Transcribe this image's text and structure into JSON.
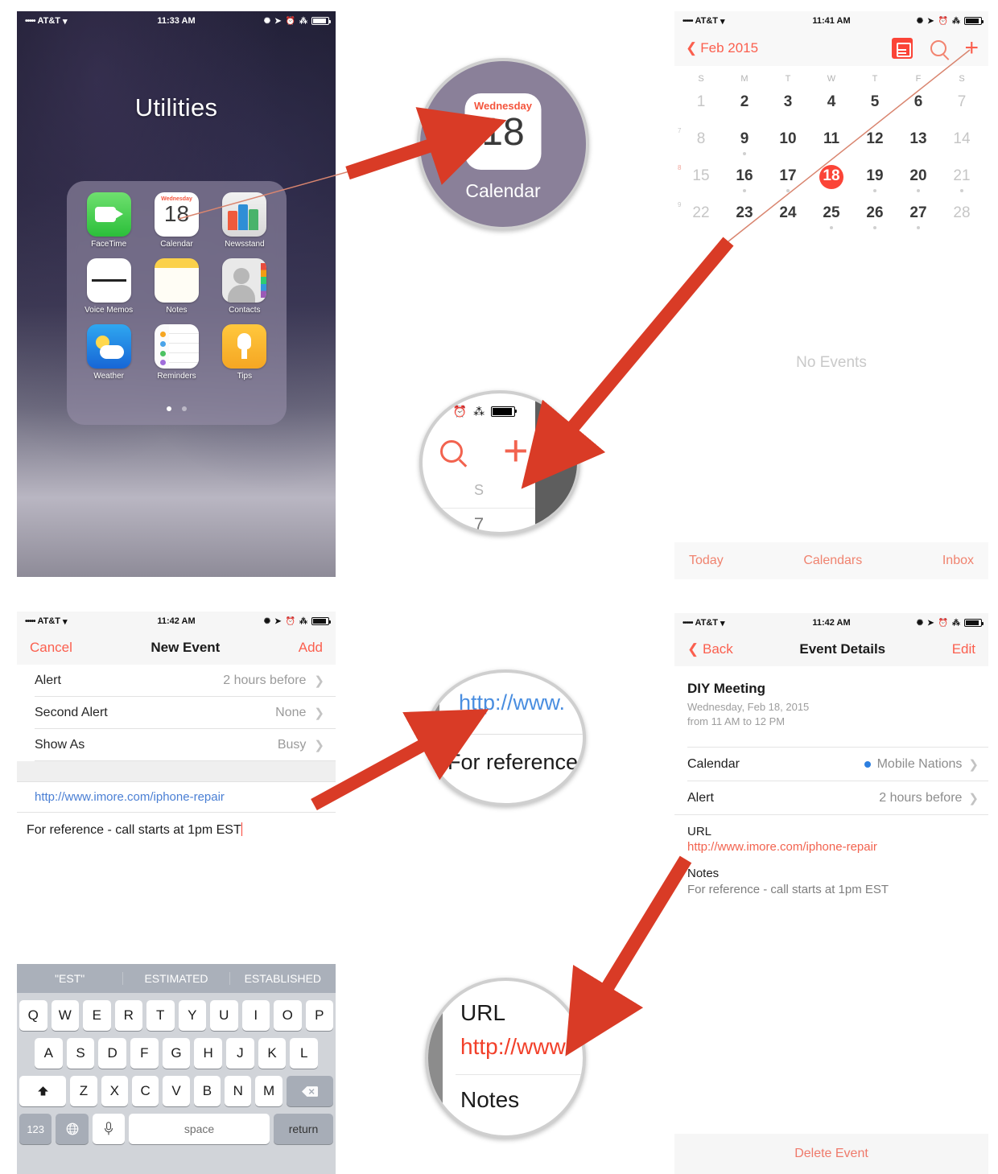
{
  "home": {
    "status": {
      "dots": "•••••",
      "carrier": "AT&T",
      "wifi": "wifi-icon",
      "time": "11:33 AM"
    },
    "folder_title": "Utilities",
    "apps": [
      {
        "label": "FaceTime",
        "icon": "facetime-icon"
      },
      {
        "label": "Calendar",
        "icon": "calendar-icon",
        "day": "Wednesday",
        "date": "18"
      },
      {
        "label": "Newsstand",
        "icon": "newsstand-icon"
      },
      {
        "label": "Voice Memos",
        "icon": "voice-memos-icon"
      },
      {
        "label": "Notes",
        "icon": "notes-icon"
      },
      {
        "label": "Contacts",
        "icon": "contacts-icon"
      },
      {
        "label": "Weather",
        "icon": "weather-icon"
      },
      {
        "label": "Reminders",
        "icon": "reminders-icon"
      },
      {
        "label": "Tips",
        "icon": "tips-icon"
      }
    ],
    "page_dots": 2,
    "active_page": 1
  },
  "calendar_month": {
    "status": {
      "dots": "•••••",
      "carrier": "AT&T",
      "time": "11:41 AM"
    },
    "back_label": "Feb 2015",
    "icons": [
      "list-view-icon",
      "search-icon",
      "add-icon"
    ],
    "dow": [
      "S",
      "M",
      "T",
      "W",
      "T",
      "F",
      "S"
    ],
    "week_numbers": [
      "",
      "7",
      "8",
      "9"
    ],
    "weeks": [
      [
        {
          "v": "1",
          "dim": true
        },
        {
          "v": "2"
        },
        {
          "v": "3"
        },
        {
          "v": "4"
        },
        {
          "v": "5"
        },
        {
          "v": "6"
        },
        {
          "v": "7",
          "dim": true
        }
      ],
      [
        {
          "v": "8",
          "dim": true
        },
        {
          "v": "9",
          "dot": true
        },
        {
          "v": "10"
        },
        {
          "v": "11"
        },
        {
          "v": "12"
        },
        {
          "v": "13"
        },
        {
          "v": "14",
          "dim": true
        }
      ],
      [
        {
          "v": "15",
          "dim": true
        },
        {
          "v": "16",
          "dot": true
        },
        {
          "v": "17",
          "dot": true
        },
        {
          "v": "18",
          "today": true
        },
        {
          "v": "19",
          "dot": true
        },
        {
          "v": "20",
          "dot": true
        },
        {
          "v": "21",
          "dim": true,
          "dot": true
        }
      ],
      [
        {
          "v": "22",
          "dim": true
        },
        {
          "v": "23"
        },
        {
          "v": "24"
        },
        {
          "v": "25",
          "dot": true
        },
        {
          "v": "26",
          "dot": true
        },
        {
          "v": "27",
          "dot": true
        },
        {
          "v": "28",
          "dim": true
        }
      ]
    ],
    "empty_state": "No Events",
    "toolbar": {
      "today": "Today",
      "calendars": "Calendars",
      "inbox": "Inbox"
    }
  },
  "new_event": {
    "status": {
      "dots": "•••••",
      "carrier": "AT&T",
      "time": "11:42 AM"
    },
    "cancel_label": "Cancel",
    "title": "New Event",
    "add_label": "Add",
    "rows": [
      {
        "label": "Alert",
        "value": "2 hours before"
      },
      {
        "label": "Second Alert",
        "value": "None"
      },
      {
        "label": "Show As",
        "value": "Busy"
      }
    ],
    "url_value": "http://www.imore.com/iphone-repair",
    "notes_value": "For reference - call starts at 1pm EST"
  },
  "event_details": {
    "status": {
      "dots": "•••••",
      "carrier": "AT&T",
      "time": "11:42 AM"
    },
    "back_label": "Back",
    "title": "Event Details",
    "edit_label": "Edit",
    "event_title": "DIY Meeting",
    "event_date": "Wednesday, Feb 18, 2015",
    "event_time": "from 11 AM to 12 PM",
    "rows": [
      {
        "label": "Calendar",
        "value": "Mobile Nations",
        "dot_color": "#2d7fe0"
      },
      {
        "label": "Alert",
        "value": "2 hours before"
      }
    ],
    "url_label": "URL",
    "url_value": "http://www.imore.com/iphone-repair",
    "notes_label": "Notes",
    "notes_value": "For reference - call starts at 1pm EST",
    "delete_label": "Delete Event"
  },
  "keyboard": {
    "suggestions": [
      "\"EST\"",
      "ESTIMATED",
      "ESTABLISHED"
    ],
    "row1": [
      "Q",
      "W",
      "E",
      "R",
      "T",
      "Y",
      "U",
      "I",
      "O",
      "P"
    ],
    "row2": [
      "A",
      "S",
      "D",
      "F",
      "G",
      "H",
      "J",
      "K",
      "L"
    ],
    "row3": [
      "Z",
      "X",
      "C",
      "V",
      "B",
      "N",
      "M"
    ],
    "shift_label": "shift-icon",
    "backspace_label": "backspace-icon",
    "numbers_label": "123",
    "globe_label": "globe-icon",
    "mic_label": "microphone-icon",
    "space_label": "space",
    "return_label": "return"
  },
  "callouts": {
    "one": {
      "day": "Wednesday",
      "date": "18",
      "label": "Calendar"
    },
    "two": {
      "search": "search-icon",
      "plus": "add-icon",
      "s": "S",
      "seven": "7"
    },
    "three": {
      "url": "http://www.",
      "notes": "For reference"
    },
    "four": {
      "url_label": "URL",
      "url": "http://www.",
      "notes_label": "Notes"
    }
  },
  "colors": {
    "accent_red": "#fb4437",
    "link_red": "#f2634f",
    "link_blue": "#4a8ee0",
    "arrow_red": "#d93b26"
  }
}
